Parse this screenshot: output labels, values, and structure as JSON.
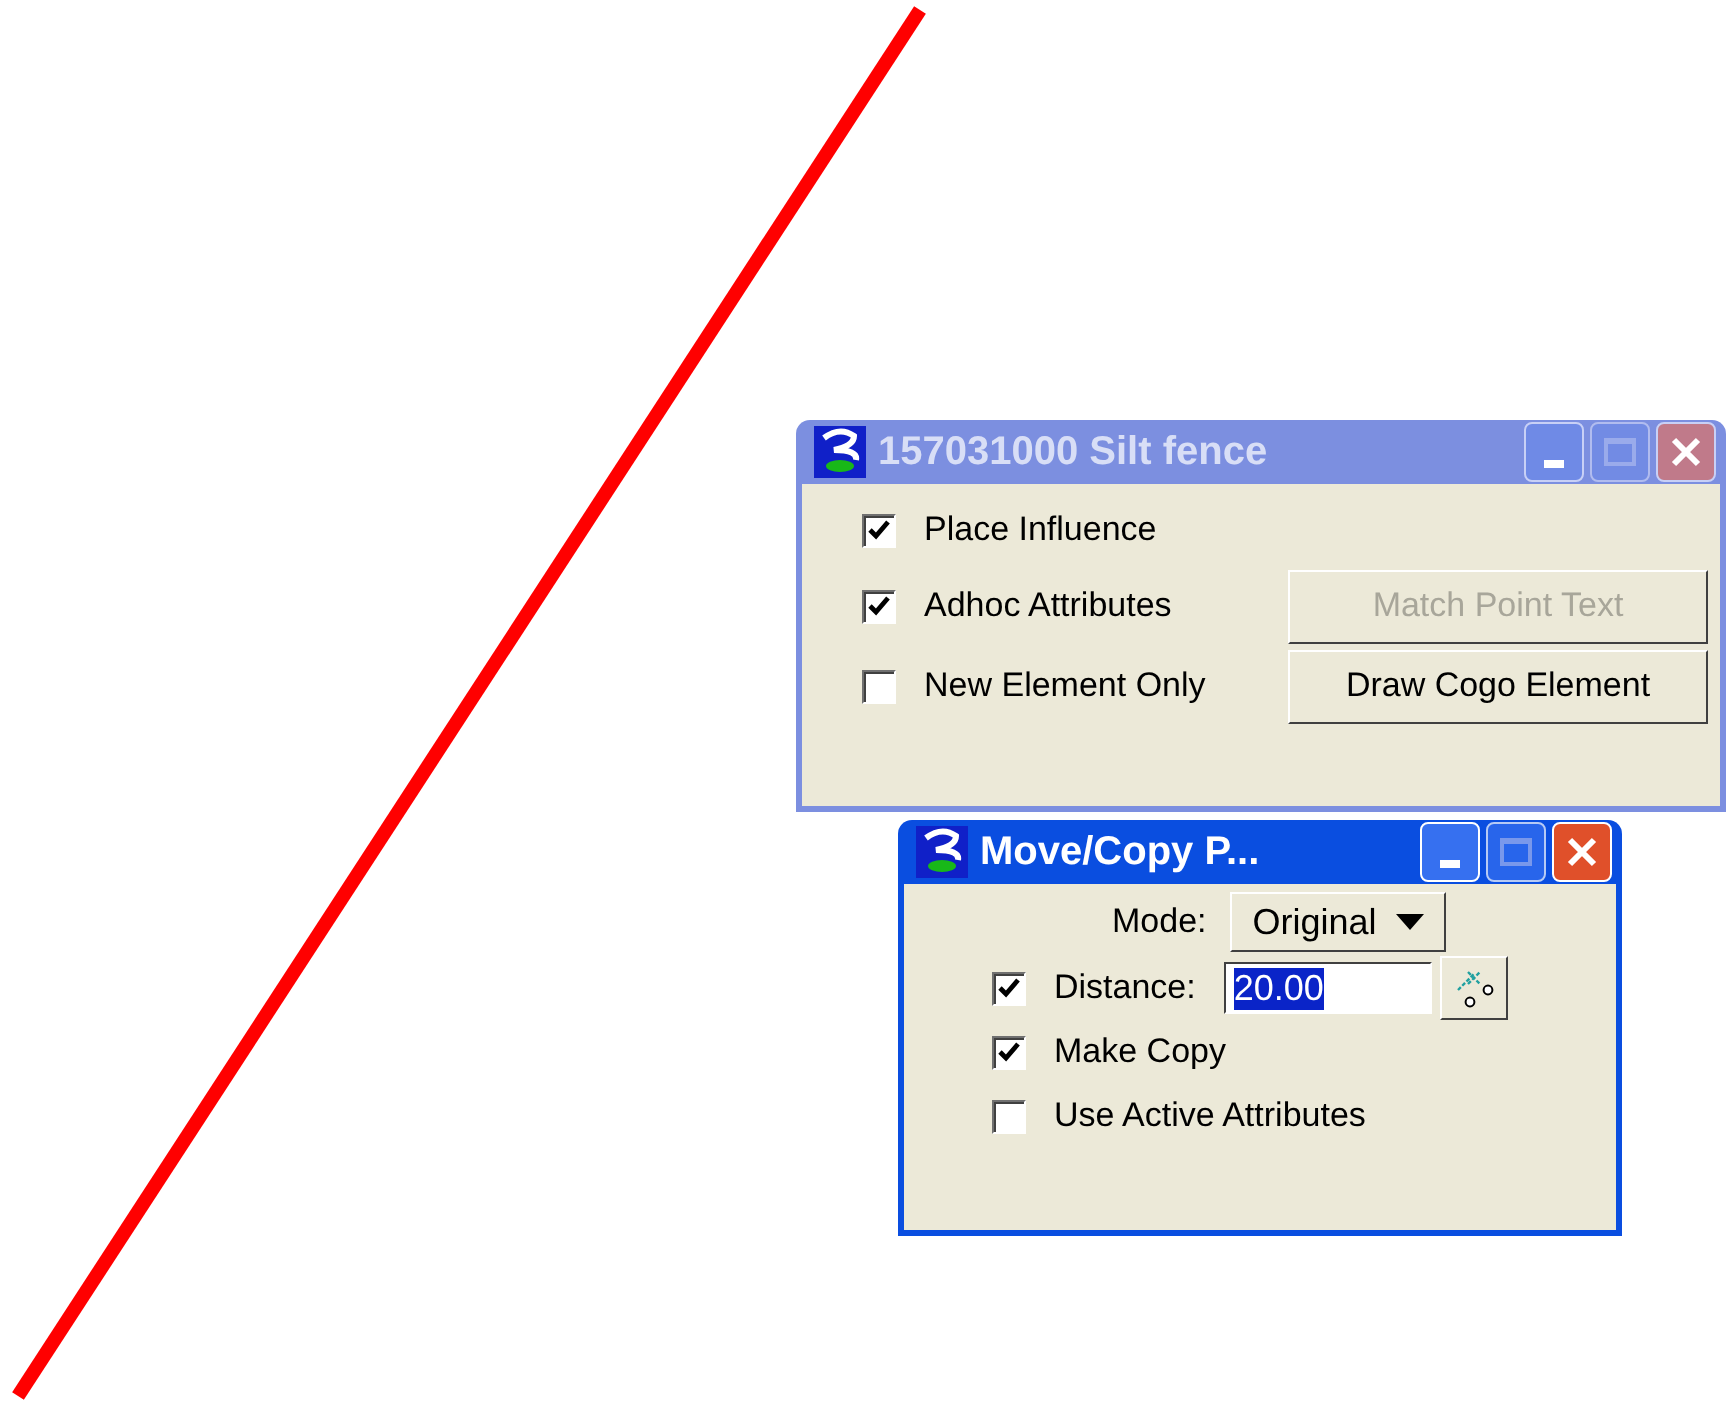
{
  "windows": [
    {
      "title": "157031000 Silt fence",
      "active": false,
      "checkboxes": [
        {
          "label": "Place Influence",
          "checked": true
        },
        {
          "label": "Adhoc Attributes",
          "checked": true
        },
        {
          "label": "New Element Only",
          "checked": false
        }
      ],
      "buttons": [
        {
          "label": "Match Point Text",
          "disabled": true
        },
        {
          "label": "Draw Cogo Element",
          "disabled": false
        }
      ]
    },
    {
      "title": "Move/Copy P...",
      "active": true,
      "mode": {
        "label": "Mode:",
        "value": "Original"
      },
      "distance": {
        "label": "Distance:",
        "checked": true,
        "value": "20.00"
      },
      "checkboxes": [
        {
          "label": "Make Copy",
          "checked": true
        },
        {
          "label": "Use Active Attributes",
          "checked": false
        }
      ]
    }
  ]
}
